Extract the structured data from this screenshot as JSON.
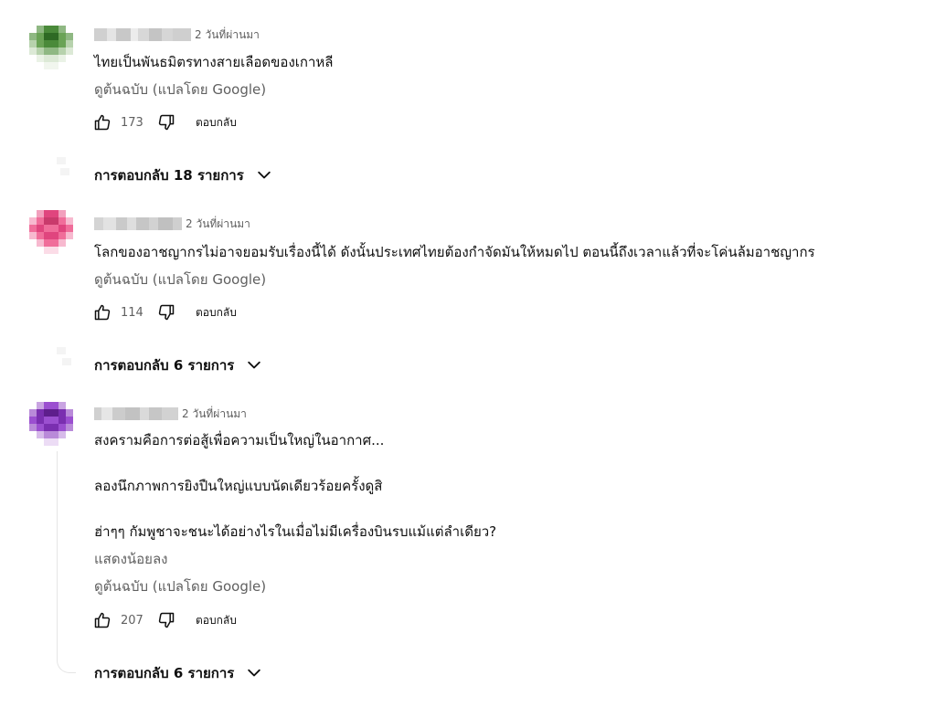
{
  "comments": [
    {
      "timestamp": "2 วันที่ผ่านมา",
      "lines": [
        "ไทยเป็นพันธมิตรทางสายเลือดของเกาหลี"
      ],
      "show_less": null,
      "translate_label": "ดูต้นฉบับ (แปลโดย Google)",
      "likes": "173",
      "reply_label": "ตอบกลับ",
      "replies_label": "การตอบกลับ 18 รายการ",
      "avatar_colors": [
        "#4a8a3a",
        "#6aa356",
        "#2e6a24",
        "#b7d2ad"
      ]
    },
    {
      "timestamp": "2 วันที่ผ่านมา",
      "lines": [
        "โลกของอาชญากรไม่อาจยอมรับเรื่องนี้ได้ ดังนั้นประเทศไทยต้องกำจัดมันให้หมดไป ตอนนี้ถึงเวลาแล้วที่จะโค่นล้มอาชญากร"
      ],
      "show_less": null,
      "translate_label": "ดูต้นฉบับ (แปลโดย Google)",
      "likes": "114",
      "reply_label": "ตอบกลับ",
      "replies_label": "การตอบกลับ 6 รายการ",
      "avatar_colors": [
        "#e0457e",
        "#f06d9a",
        "#c93a6c",
        "#f7b9cf"
      ]
    },
    {
      "timestamp": "2 วันที่ผ่านมา",
      "lines": [
        "สงครามคือการต่อสู้เพื่อความเป็นใหญ่ในอากาศ...",
        "ลองนึกภาพการยิงปืนใหญ่แบบนัดเดียวร้อยครั้งดูสิ",
        "ฮ่าๆๆ กัมพูชาจะชนะได้อย่างไรในเมื่อไม่มีเครื่องบินรบแม้แต่ลำเดียว?"
      ],
      "show_less": "แสดงน้อยลง",
      "translate_label": "ดูต้นฉบับ (แปลโดย Google)",
      "likes": "207",
      "reply_label": "ตอบกลับ",
      "replies_label": "การตอบกลับ 6 รายการ",
      "avatar_colors": [
        "#7a2fb0",
        "#9b4fd0",
        "#5e1e8c",
        "#d7bbea"
      ]
    }
  ],
  "icons": {
    "like": "thumb-up-icon",
    "dislike": "thumb-down-icon",
    "expand": "chevron-down-icon"
  }
}
